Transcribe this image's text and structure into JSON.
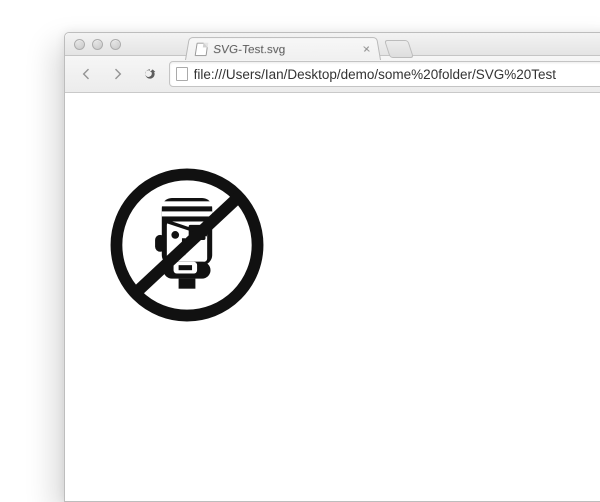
{
  "tab": {
    "title": "SVG-Test.svg",
    "close_glyph": "×"
  },
  "address_bar": {
    "url": "file:///Users/Ian/Desktop/demo/some%20folder/SVG%20Test"
  },
  "content": {
    "image_name": "no-piracy-icon"
  }
}
